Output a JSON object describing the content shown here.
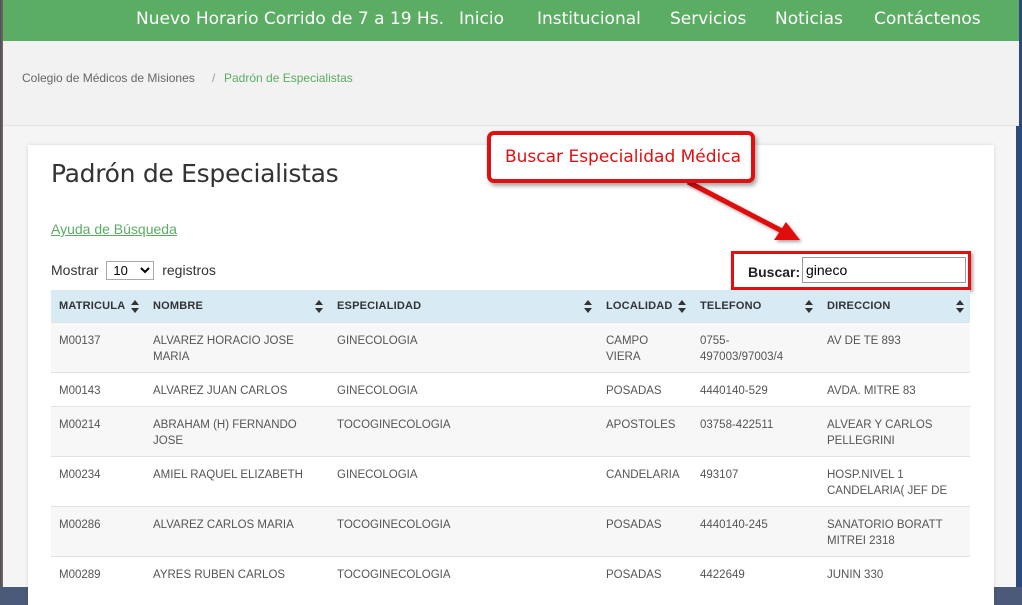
{
  "nav": {
    "items": [
      "Nuevo Horario Corrido de 7 a 19 Hs.",
      "Inicio",
      "Institucional",
      "Servicios",
      "Noticias",
      "Contáctenos"
    ]
  },
  "breadcrumb": {
    "home": "Colegio de Médicos de Misiones",
    "separator": "/",
    "current": "Padrón de Especialistas"
  },
  "page": {
    "title": "Padrón de Especialistas",
    "help_link": "Ayuda de Búsqueda",
    "show_label": "Mostrar",
    "show_value": "10",
    "records_label": "registros",
    "search_label": "Buscar:",
    "search_value": "gineco"
  },
  "annotation": {
    "callout_text": "Buscar Especialidad Médica"
  },
  "table": {
    "headers": [
      "MATRICULA",
      "NOMBRE",
      "ESPECIALIDAD",
      "LOCALIDAD",
      "TELEFONO",
      "DIRECCION"
    ],
    "rows": [
      [
        "M00137",
        "ALVAREZ HORACIO JOSE MARIA",
        "GINECOLOGIA",
        "CAMPO VIERA",
        "0755-497003/97003/4",
        "AV DE TE 893"
      ],
      [
        "M00143",
        "ALVAREZ JUAN CARLOS",
        "GINECOLOGIA",
        "POSADAS",
        "4440140-529",
        "AVDA. MITRE 83"
      ],
      [
        "M00214",
        "ABRAHAM (H) FERNANDO JOSE",
        "TOCOGINECOLOGIA",
        "APOSTOLES",
        "03758-422511",
        "ALVEAR Y CARLOS PELLEGRINI"
      ],
      [
        "M00234",
        "AMIEL RAQUEL ELIZABETH",
        "GINECOLOGIA",
        "CANDELARIA",
        "493107",
        "HOSP.NIVEL 1 CANDELARIA( JEF DE"
      ],
      [
        "M00286",
        "ALVAREZ CARLOS MARIA",
        "TOCOGINECOLOGIA",
        "POSADAS",
        "4440140-245",
        "SANATORIO BORATT MITREI 2318"
      ],
      [
        "M00289",
        "AYRES RUBEN CARLOS",
        "TOCOGINECOLOGIA",
        "POSADAS",
        "4422649",
        "JUNIN 330"
      ]
    ]
  },
  "colors": {
    "nav_bg": "#5aad63",
    "accent_green": "#5aad63",
    "header_row": "#d8ebf5",
    "annotation_red": "#e01010"
  }
}
